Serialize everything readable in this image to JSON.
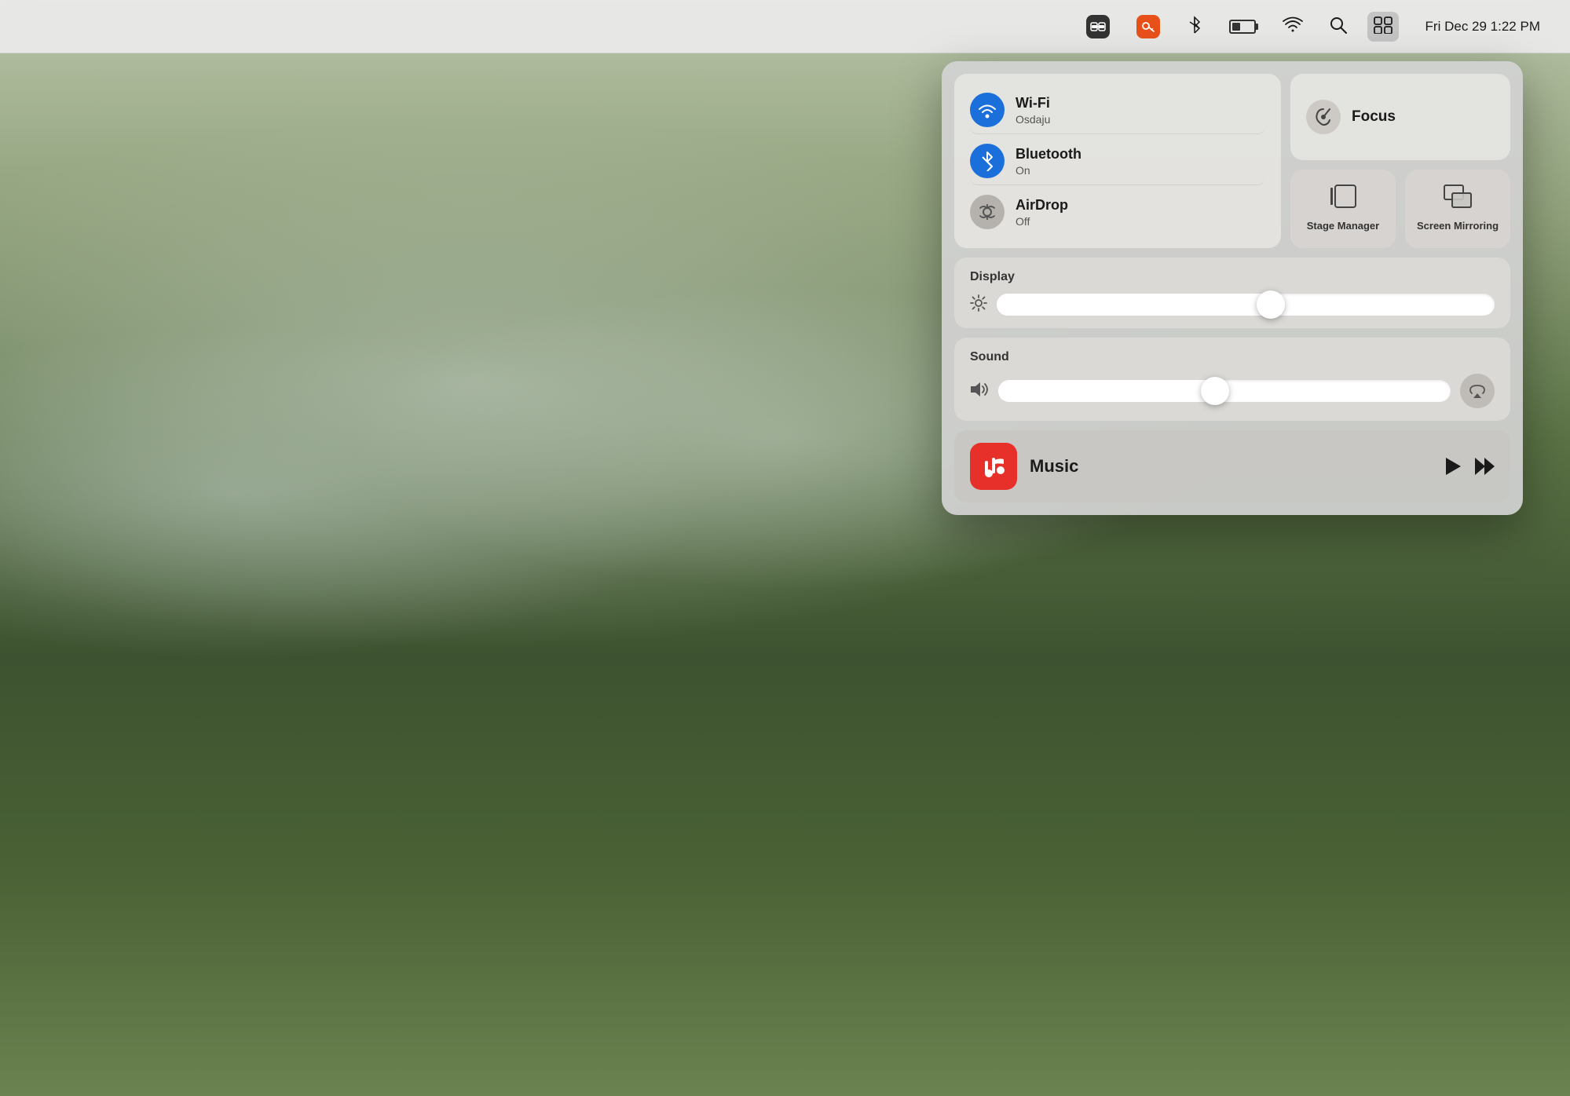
{
  "desktop": {
    "bg_description": "Mountain landscape with fog and forest"
  },
  "menubar": {
    "datetime": "Fri Dec 29  1:22 PM",
    "items": [
      {
        "id": "teamviewer",
        "label": "TeamViewer",
        "symbol": "⇄"
      },
      {
        "id": "key-app",
        "label": "Key App",
        "symbol": "🔑"
      },
      {
        "id": "bluetooth",
        "label": "Bluetooth",
        "symbol": "✻"
      },
      {
        "id": "battery",
        "label": "Battery",
        "symbol": "battery"
      },
      {
        "id": "wifi-menu",
        "label": "Wi-Fi",
        "symbol": "wifi"
      },
      {
        "id": "spotlight",
        "label": "Spotlight",
        "symbol": "🔍"
      },
      {
        "id": "control-center",
        "label": "Control Center",
        "symbol": "⚙"
      }
    ]
  },
  "control_center": {
    "connectivity": {
      "wifi": {
        "title": "Wi-Fi",
        "subtitle": "Osdaju",
        "status": "on"
      },
      "bluetooth": {
        "title": "Bluetooth",
        "subtitle": "On",
        "status": "on"
      },
      "airdrop": {
        "title": "AirDrop",
        "subtitle": "Off",
        "status": "off"
      }
    },
    "focus": {
      "label": "Focus"
    },
    "stage_manager": {
      "label": "Stage Manager"
    },
    "screen_mirroring": {
      "label": "Screen Mirroring"
    },
    "display": {
      "label": "Display",
      "brightness": 55,
      "icon": "☀"
    },
    "sound": {
      "label": "Sound",
      "volume": 48,
      "icon": "🔊",
      "airplay_label": "AirPlay"
    },
    "music": {
      "label": "Music",
      "app_icon": "♪",
      "play_label": "Play",
      "skip_label": "Skip"
    }
  }
}
